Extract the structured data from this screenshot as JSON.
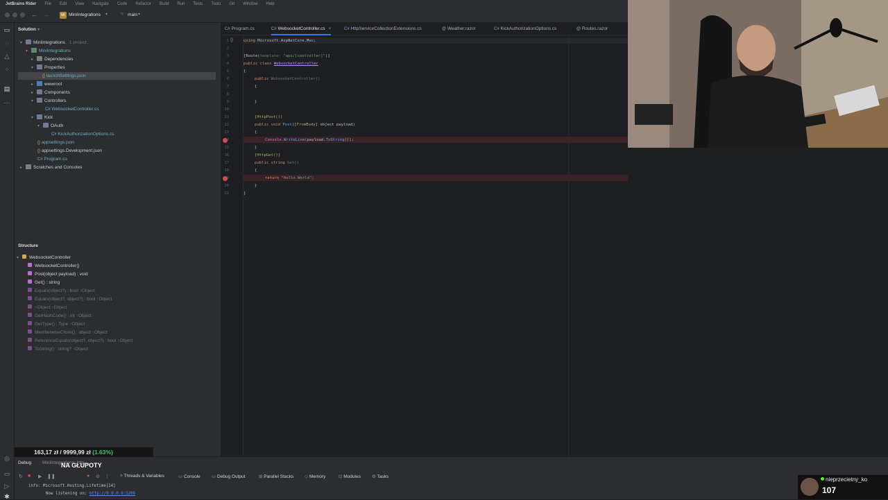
{
  "menubar": {
    "app": "JetBrains Rider",
    "items": [
      "File",
      "Edit",
      "View",
      "Navigate",
      "Code",
      "Refactor",
      "Build",
      "Run",
      "Tests",
      "Tools",
      "Git",
      "Window",
      "Help"
    ]
  },
  "toolbar": {
    "project": "MiniIntegrations",
    "branch": "main"
  },
  "solution": {
    "header": "Solution",
    "root": "MiniIntegrations",
    "root_meta": "1 project",
    "items": [
      {
        "label": "MiniIntegrations",
        "depth": 1,
        "kind": "project"
      },
      {
        "label": "Dependencies",
        "depth": 2,
        "kind": "folder"
      },
      {
        "label": "Properties",
        "depth": 2,
        "kind": "folder"
      },
      {
        "label": "launchSettings.json",
        "depth": 3,
        "kind": "json"
      },
      {
        "label": "wwwroot",
        "depth": 2,
        "kind": "folder"
      },
      {
        "label": "Components",
        "depth": 2,
        "kind": "folder"
      },
      {
        "label": "Controllers",
        "depth": 2,
        "kind": "folder"
      },
      {
        "label": "WebsocketController.cs",
        "depth": 3,
        "kind": "cs"
      },
      {
        "label": "Kick",
        "depth": 2,
        "kind": "folder"
      },
      {
        "label": "OAuth",
        "depth": 3,
        "kind": "folder"
      },
      {
        "label": "KickAuthorizationOptions.cs",
        "depth": 4,
        "kind": "cs"
      },
      {
        "label": "appsettings.json",
        "depth": 2,
        "kind": "json"
      },
      {
        "label": "appsettings.Development.json",
        "depth": 2,
        "kind": "json"
      },
      {
        "label": "Program.cs",
        "depth": 2,
        "kind": "cs"
      }
    ],
    "scratches": "Scratches and Consoles"
  },
  "tabs": [
    "Program.cs",
    "WebsocketController.cs",
    "HttpServiceCollectionExtensions.cs",
    "Weather.razor",
    "KickAuthorizationOptions.cs",
    "Routes.razor"
  ],
  "editor": {
    "line_numbers": [
      "1",
      "2",
      "3",
      "4",
      "5",
      "6",
      "7",
      "8",
      "9",
      "10",
      "11",
      "12",
      "13",
      "14",
      "15",
      "16",
      "17",
      "18",
      "19",
      "20",
      "21"
    ],
    "l1_using": "using",
    "l1_ns": "Microsoft.AspNetCore.Mvc;",
    "l3_route": "[Route(",
    "l3_hint": "template:",
    "l3_str": "\"api/[controller]\"",
    "l3_end": ")]",
    "l4_public": "public class",
    "l4_name": "WebsocketController",
    "l5_brace": "{",
    "l6_public": "public",
    "l6_ctor": "WebsocketController()",
    "l7_brace": "{",
    "l9_brace": "}",
    "l11_attr": "[HttpPost()]",
    "l12_sig1": "public void",
    "l12_name": "Post",
    "l12_paren": "([",
    "l12_attr": "FromBody",
    "l12_rest": "] object payload)",
    "l13_brace": "{",
    "l14_console": "Console.",
    "l14_write": "WriteLine",
    "l14_rest": "(payload.",
    "l14_tostr": "ToString",
    "l14_end": "());",
    "l15_brace": "}",
    "l16_attr": "[HttpGet()]",
    "l17_sig": "public string",
    "l17_name": "Get()",
    "l18_brace": "{",
    "l19_return": "return",
    "l19_str": "\"Hello World\";",
    "l20_brace": "}",
    "l21_brace": "}"
  },
  "structure": {
    "header": "Structure",
    "class": "WebsocketController",
    "members": [
      {
        "label": "WebsocketController()",
        "muted": false
      },
      {
        "label": "Post(object payload) : void",
        "muted": false
      },
      {
        "label": "Get() : string",
        "muted": false
      },
      {
        "label": "Equals(object?) : bool ↑Object",
        "muted": true
      },
      {
        "label": "Equals(object?, object?) : bool ↑Object",
        "muted": true
      },
      {
        "label": "~Object ↑Object",
        "muted": true
      },
      {
        "label": "GetHashCode() : int ↑Object",
        "muted": true
      },
      {
        "label": "GetType() : Type ↑Object",
        "muted": true
      },
      {
        "label": "MemberwiseClone() : object ↑Object",
        "muted": true
      },
      {
        "label": "ReferenceEquals(object?, object?) : bool ↑Object",
        "muted": true
      },
      {
        "label": "ToString() : string? ↑Object",
        "muted": true
      }
    ]
  },
  "overlay": {
    "stock": "163,17 zł / 9999,99 zł",
    "stock_pct": "(1.63%)",
    "caption": "NA GŁUPOTY",
    "follower_name": "nieprzecietny_ko",
    "follower_count": "107"
  },
  "debug": {
    "label": "Debug",
    "config": "MiniIntegrations: http",
    "tabs": [
      "Threads & Variables",
      "Console",
      "Debug Output",
      "Parallel Stacks",
      "Memory",
      "Modules",
      "Tasks"
    ],
    "console_line1_prefix": "info:",
    "console_line1": "Microsoft.Hosting.Lifetime[14]",
    "console_line2": "Now listening on:",
    "console_url": "http://0.0.0.0:5206"
  },
  "colors": {
    "bg": "#1e1f22",
    "panel": "#2b2d30",
    "accent": "#3574f0",
    "breakpoint": "#c94f4f"
  }
}
